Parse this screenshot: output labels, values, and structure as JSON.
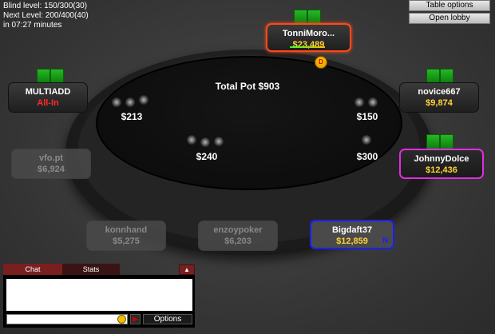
{
  "info": {
    "blind_level": "Blind level: 150/300(30)",
    "next_level": "Next Level: 200/400(40)",
    "time_left": "in 07:27 minutes"
  },
  "toolbar": {
    "table_options": "Table options",
    "open_lobby": "Open lobby"
  },
  "pot": {
    "label": "Total Pot $903"
  },
  "dealer": {
    "symbol": "D"
  },
  "seats": [
    {
      "name": "TonniMoro...",
      "stack": "$23,489",
      "state": "active"
    },
    {
      "name": "MULTIADD",
      "stack": "All-In",
      "state": "allin"
    },
    {
      "name": "novice667",
      "stack": "$9,874",
      "state": "normal"
    },
    {
      "name": "vfo.pt",
      "stack": "$6,924",
      "state": "sitout"
    },
    {
      "name": "JohnnyDolce",
      "stack": "$12,436",
      "state": "highlighted"
    },
    {
      "name": "konnhand",
      "stack": "$5,275",
      "state": "sitout"
    },
    {
      "name": "enzoypoker",
      "stack": "$6,203",
      "state": "sitout"
    },
    {
      "name": "Bigdaft37",
      "stack": "$12,859",
      "state": "hero",
      "badge": "N"
    }
  ],
  "bets": [
    {
      "amount": "$213"
    },
    {
      "amount": "$150"
    },
    {
      "amount": "$240"
    },
    {
      "amount": "$300"
    }
  ],
  "chat": {
    "tab_chat": "Chat",
    "tab_stats": "Stats",
    "input_value": "",
    "options_label": "Options",
    "send_symbol": "▶",
    "collapse_symbol": "▲"
  },
  "colors": {
    "stack_gold": "#ffd23a",
    "allin_red": "#ff2a2a",
    "active_border": "#ff4a1a",
    "highlight_border": "#e02ee0",
    "hero_border": "#1a20ff",
    "card_green": "#25b825"
  }
}
